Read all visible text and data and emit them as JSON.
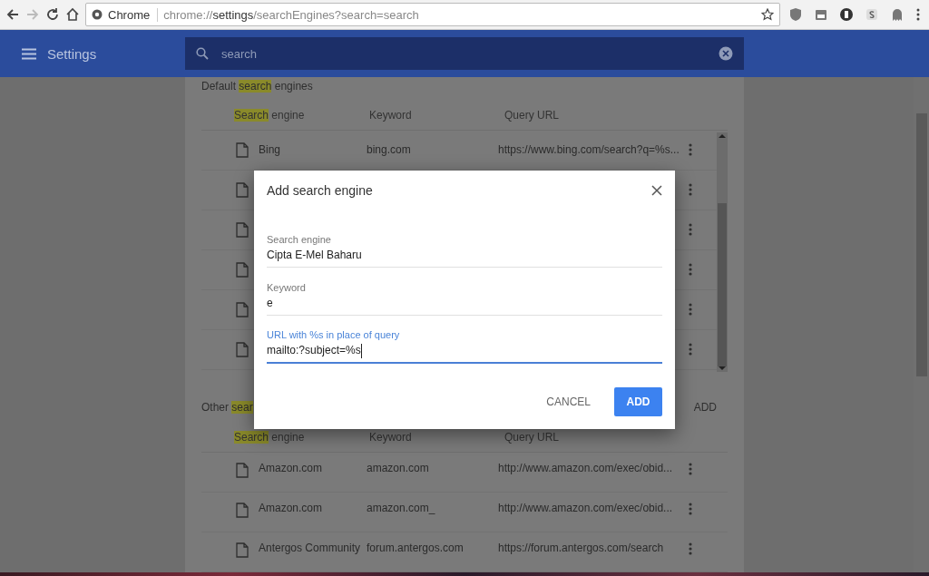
{
  "browser": {
    "site_label": "Chrome",
    "url_prefix": "chrome://",
    "url_host": "settings",
    "url_path": "/searchEngines?search=search"
  },
  "header": {
    "title": "Settings",
    "search_value": "search"
  },
  "default_section": {
    "title_parts": [
      {
        "text": "Default ",
        "highlighted": false
      },
      {
        "text": "search",
        "highlighted": true
      },
      {
        "text": " engines",
        "highlighted": false
      }
    ],
    "columns": [
      {
        "parts": [
          {
            "text": "Search",
            "highlighted": true
          },
          {
            "text": " engine",
            "highlighted": false
          }
        ]
      },
      {
        "parts": [
          {
            "text": "Keyword",
            "highlighted": false
          }
        ]
      },
      {
        "parts": [
          {
            "text": "Query URL",
            "highlighted": false
          }
        ]
      }
    ],
    "rows": [
      {
        "kind": "entry",
        "name": "Bing",
        "keyword": "bing.com",
        "url": "https://www.bing.com/search?q=%s..."
      },
      {
        "kind": "covered"
      },
      {
        "kind": "covered"
      },
      {
        "kind": "covered"
      },
      {
        "kind": "covered"
      },
      {
        "kind": "covered"
      }
    ]
  },
  "other_section": {
    "title_parts": [
      {
        "text": "Other ",
        "highlighted": false
      },
      {
        "text": "sear",
        "highlighted": true
      }
    ],
    "add_label": "ADD",
    "columns": [
      {
        "parts": [
          {
            "text": "Search",
            "highlighted": true
          },
          {
            "text": " engine",
            "highlighted": false
          }
        ]
      },
      {
        "parts": [
          {
            "text": "Keyword",
            "highlighted": false
          }
        ]
      },
      {
        "parts": [
          {
            "text": "Query URL",
            "highlighted": false
          }
        ]
      }
    ],
    "rows": [
      {
        "kind": "entry",
        "name": "Amazon.com",
        "keyword": "amazon.com",
        "url": "http://www.amazon.com/exec/obid..."
      },
      {
        "kind": "entry",
        "name": "Amazon.com",
        "keyword": "amazon.com_",
        "url": "http://www.amazon.com/exec/obid..."
      },
      {
        "kind": "entry",
        "name": "Antergos Community",
        "keyword": "forum.antergos.com",
        "url": "https://forum.antergos.com/search"
      }
    ]
  },
  "dialog": {
    "title": "Add search engine",
    "fields": [
      {
        "label": "Search engine",
        "value": "Cipta E-Mel Baharu",
        "focused": false
      },
      {
        "label": "Keyword",
        "value": "e",
        "focused": false
      },
      {
        "label": "URL with %s in place of query",
        "value": "mailto:?subject=%s",
        "focused": true
      }
    ],
    "cancel_label": "CANCEL",
    "add_label": "ADD"
  }
}
